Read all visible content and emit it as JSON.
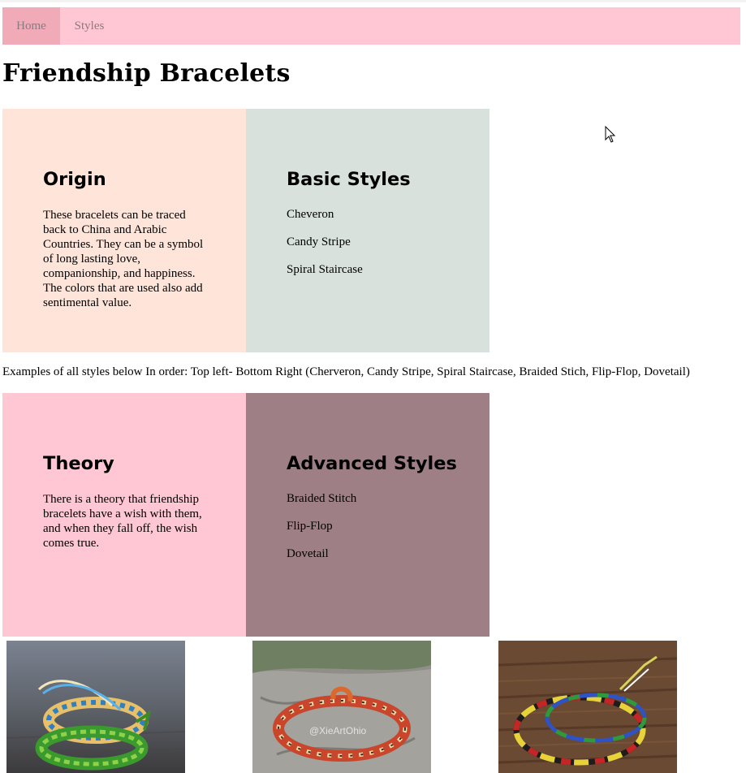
{
  "nav": {
    "items": [
      {
        "label": "Home",
        "active": true
      },
      {
        "label": "Styles",
        "active": false
      }
    ]
  },
  "page_title": "Friendship Bracelets",
  "origin": {
    "heading": "Origin",
    "text": "These bracelets can be traced back to China and Arabic Countries. They can be a symbol of long lasting love, companionship, and happiness. The colors that are used also add sentimental value."
  },
  "basic_styles": {
    "heading": "Basic Styles",
    "items": [
      "Cheveron",
      "Candy Stripe",
      "Spiral Staircase"
    ]
  },
  "examples_text": "Examples of all styles below In order: Top left- Bottom Right (Cherveron, Candy Stripe, Spiral Staircase, Braided Stich, Flip-Flop, Dovetail)",
  "theory": {
    "heading": "Theory",
    "text": "There is a theory that friendship bracelets have a wish with them, and when they fall off, the wish comes true."
  },
  "advanced_styles": {
    "heading": "Advanced Styles",
    "items": [
      "Braided Stitch",
      "Flip-Flop",
      "Dovetail"
    ]
  },
  "photos": [
    {
      "name": "chevron-bracelet-photo"
    },
    {
      "name": "candy-stripe-bracelet-photo",
      "watermark": "@XieArtOhio"
    },
    {
      "name": "spiral-staircase-bracelet-photo"
    }
  ],
  "colors": {
    "nav_bg": "#ffc7d3",
    "nav_active_bg": "#f0aab8",
    "origin_bg": "#ffe4d9",
    "basic_bg": "#d8e1dc",
    "theory_bg": "#ffc7d3",
    "advanced_bg": "#9e7f85"
  }
}
